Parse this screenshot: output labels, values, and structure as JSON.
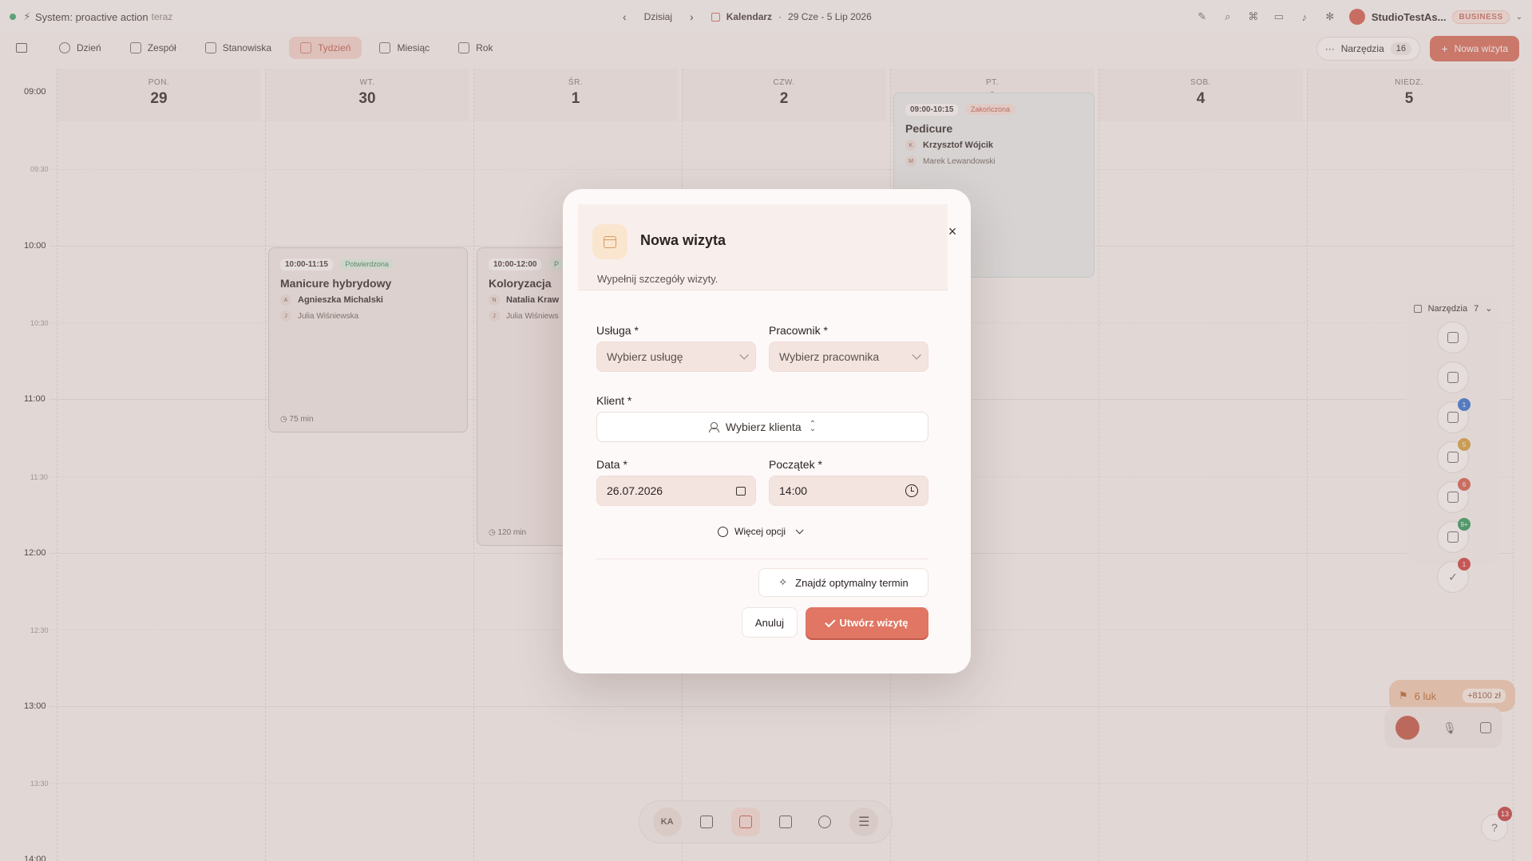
{
  "topbar": {
    "system_status": "System: proactive action",
    "system_time": "teraz",
    "today_label": "Dzisiaj",
    "calendar_label": "Kalendarz",
    "date_range": "29 Cze - 5 Lip 2026",
    "studio_name": "StudioTestAs...",
    "plan_badge": "BUSINESS"
  },
  "viewbar": {
    "tabs": [
      {
        "label": "Dzień",
        "icon": "sun-icon"
      },
      {
        "label": "Zespół",
        "icon": "team-icon"
      },
      {
        "label": "Stanowiska",
        "icon": "station-icon"
      },
      {
        "label": "Tydzień",
        "icon": "grid-icon",
        "active": true
      },
      {
        "label": "Miesiąc",
        "icon": "month-icon"
      },
      {
        "label": "Rok",
        "icon": "year-icon"
      }
    ],
    "tools_label": "Narzędzia",
    "tools_count": "16",
    "new_visit_label": "Nowa wizyta"
  },
  "calendar": {
    "days": [
      {
        "name": "PON.",
        "num": "29"
      },
      {
        "name": "WT.",
        "num": "30"
      },
      {
        "name": "ŚR.",
        "num": "1"
      },
      {
        "name": "CZW.",
        "num": "2"
      },
      {
        "name": "PT.",
        "num": "3"
      },
      {
        "name": "SOB.",
        "num": "4"
      },
      {
        "name": "NIEDZ.",
        "num": "5"
      }
    ],
    "times": [
      "09:00",
      "09:30",
      "10:00",
      "10:30",
      "11:00",
      "11:30",
      "12:00",
      "12:30",
      "13:00",
      "13:30",
      "14:00"
    ],
    "events": [
      {
        "time": "10:00-11:15",
        "status": "Potwierdzona",
        "title": "Manicure hybrydowy",
        "client": "Agnieszka Michalski",
        "client_initial": "A",
        "staff": "Julia Wiśniewska",
        "staff_initial": "J",
        "duration": "75 min"
      },
      {
        "time": "10:00-12:00",
        "status": "P",
        "title": "Koloryzacja",
        "client": "Natalia Kraw",
        "client_initial": "N",
        "staff": "Julia Wiśniews",
        "staff_initial": "J",
        "duration": "120 min"
      },
      {
        "time": "09:00-10:15",
        "status": "Zakończona",
        "title": "Pedicure",
        "client": "Krzysztof Wójcik",
        "client_initial": "K",
        "staff": "Marek Lewandowski",
        "staff_initial": "M"
      }
    ]
  },
  "tools_panel": {
    "label": "Narzędzia",
    "count": "7",
    "buttons": [
      {
        "icon": "clipboard-icon",
        "count": ""
      },
      {
        "icon": "flag-icon",
        "count": ""
      },
      {
        "icon": "users-icon",
        "count": "1",
        "color": "#2f6fd6"
      },
      {
        "icon": "bank-icon",
        "count": "5",
        "color": "#d9a03a"
      },
      {
        "icon": "note-icon",
        "count": "6",
        "color": "#d95a4a"
      },
      {
        "icon": "inbox-icon",
        "count": "9+",
        "color": "#2a9a5a"
      },
      {
        "icon": "check-icon",
        "count": "1",
        "color": "#d23c3c"
      }
    ]
  },
  "gap_widget": {
    "label": "6 luk",
    "amount": "+8100 zł"
  },
  "dock": {
    "avatar": "KA"
  },
  "help": {
    "count": "13"
  },
  "modal": {
    "title": "Nowa wizyta",
    "subtitle": "Wypełnij szczegóły wizyty.",
    "service_label": "Usługa *",
    "service_placeholder": "Wybierz usługę",
    "staff_label": "Pracownik *",
    "staff_placeholder": "Wybierz pracownika",
    "client_label": "Klient *",
    "client_placeholder": "Wybierz klienta",
    "date_label": "Data *",
    "date_value": "26.07.2026",
    "start_label": "Początek *",
    "start_value": "14:00",
    "more_options": "Więcej opcji",
    "optimal_button": "Znajdź optymalny termin",
    "cancel_button": "Anuluj",
    "create_button": "Utwórz wizytę"
  }
}
